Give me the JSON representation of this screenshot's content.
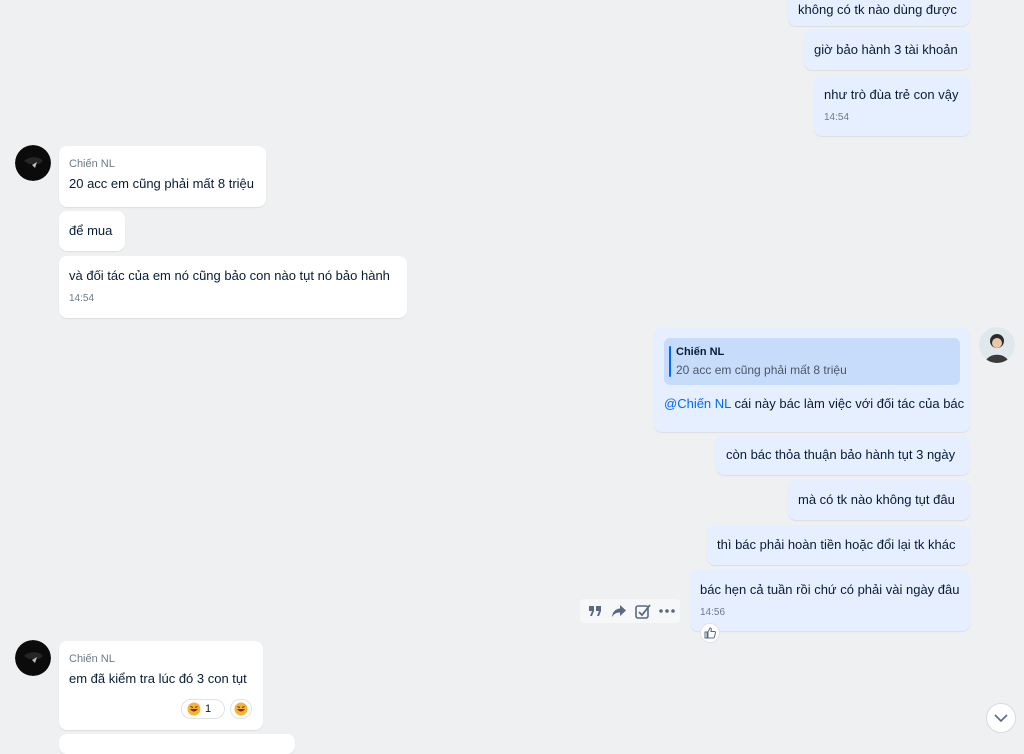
{
  "messages_top_out": [
    {
      "text": "không có tk nào dùng được"
    },
    {
      "text": "giờ bảo hành 3 tài khoản"
    },
    {
      "text": "như trò đùa trẻ con vậy",
      "time": "14:54"
    }
  ],
  "group1": {
    "sender": "Chiến NL",
    "messages": [
      {
        "text": "20 acc em cũng phải mất 8 triệu"
      },
      {
        "text": "để mua"
      },
      {
        "text": "và đối tác của em nó cũng bảo con nào tụt nó bảo hành",
        "time": "14:54"
      }
    ]
  },
  "group2": {
    "quote": {
      "name": "Chiến NL",
      "text": "20 acc em cũng phải mất 8 triệu"
    },
    "mention": "@Chiến NL",
    "first_text": " cái này bác làm việc với đối tác của bác",
    "messages": [
      {
        "text": "còn bác thỏa thuận bảo hành tụt 3 ngày"
      },
      {
        "text": "mà có tk nào không tụt đâu"
      },
      {
        "text": "thì bác phải hoàn tiền hoặc đổi lại tk khác"
      },
      {
        "text": "bác hẹn cả tuần rồi chứ có phải vài ngày đâu",
        "time": "14:56"
      }
    ]
  },
  "group3": {
    "sender": "Chiến NL",
    "messages": [
      {
        "text": "em đã kiểm tra lúc đó 3 con tụt",
        "reaction_count": "1"
      }
    ]
  },
  "icons": {
    "quote": "quote-icon",
    "forward": "forward-icon",
    "todo": "checkbox-icon",
    "more": "more-icon",
    "like": "thumbs-up-icon",
    "scroll": "chevron-down-icon"
  },
  "colors": {
    "background": "#eef0f1",
    "incoming": "#ffffff",
    "outgoing": "#e5efff",
    "accent": "#0068ff"
  }
}
